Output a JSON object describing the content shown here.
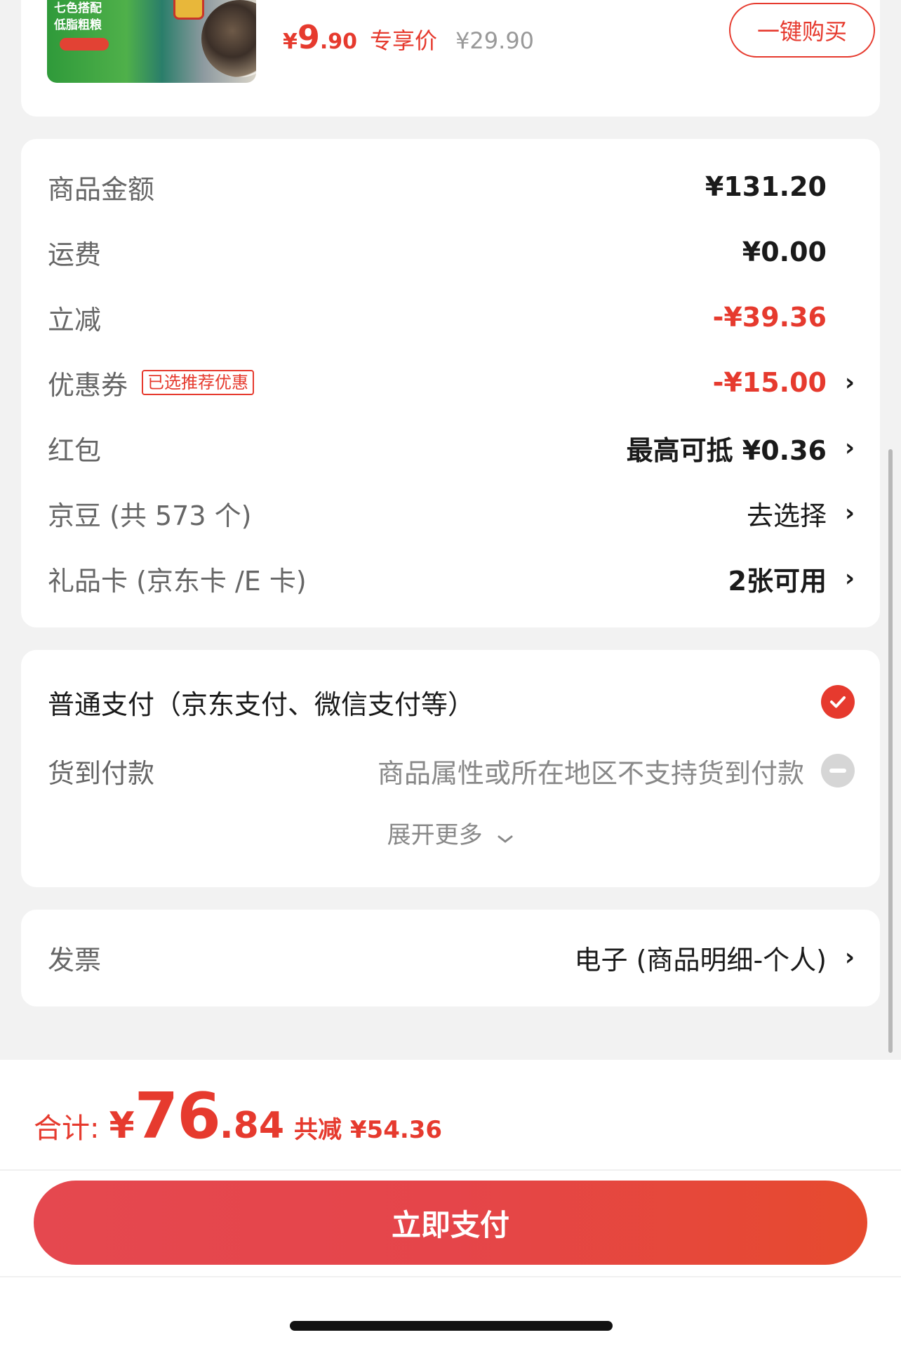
{
  "product": {
    "pkg_text_line1": "七色搭配",
    "pkg_text_line2": "低脂粗粮",
    "price_yen": "¥",
    "price_int": "9",
    "price_dec": ".90",
    "price_tag": "专享价",
    "original_price": "¥29.90",
    "buy_button": "一键购买"
  },
  "summary": {
    "goods_amount_label": "商品金额",
    "goods_amount_value": "¥131.20",
    "shipping_label": "运费",
    "shipping_value": "¥0.00",
    "instant_discount_label": "立减",
    "instant_discount_value": "-¥39.36",
    "coupon_label": "优惠券",
    "coupon_badge": "已选推荐优惠",
    "coupon_value": "-¥15.00",
    "red_packet_label": "红包",
    "red_packet_value": "最高可抵 ¥0.36",
    "jd_beans_label": "京豆 (共 573 个)",
    "jd_beans_value": "去选择",
    "gift_card_label": "礼品卡 (京东卡 /E 卡)",
    "gift_card_value": "2张可用"
  },
  "payment": {
    "normal_label": "普通支付（京东支付、微信支付等）",
    "cod_label": "货到付款",
    "cod_note": "商品属性或所在地区不支持货到付款",
    "expand_label": "展开更多"
  },
  "invoice": {
    "label": "发票",
    "value": "电子 (商品明细-个人)"
  },
  "footer": {
    "total_label": "合计:",
    "total_yen": "¥",
    "total_int": "76",
    "total_dec": ".84",
    "saved_text": "共减 ¥54.36",
    "pay_button": "立即支付"
  },
  "colors": {
    "accent": "#e63a2e",
    "background": "#f2f2f2",
    "card": "#ffffff"
  },
  "icons": [
    "chevron-right-icon",
    "check-circle-icon",
    "disabled-circle-icon",
    "chevron-down-icon"
  ]
}
